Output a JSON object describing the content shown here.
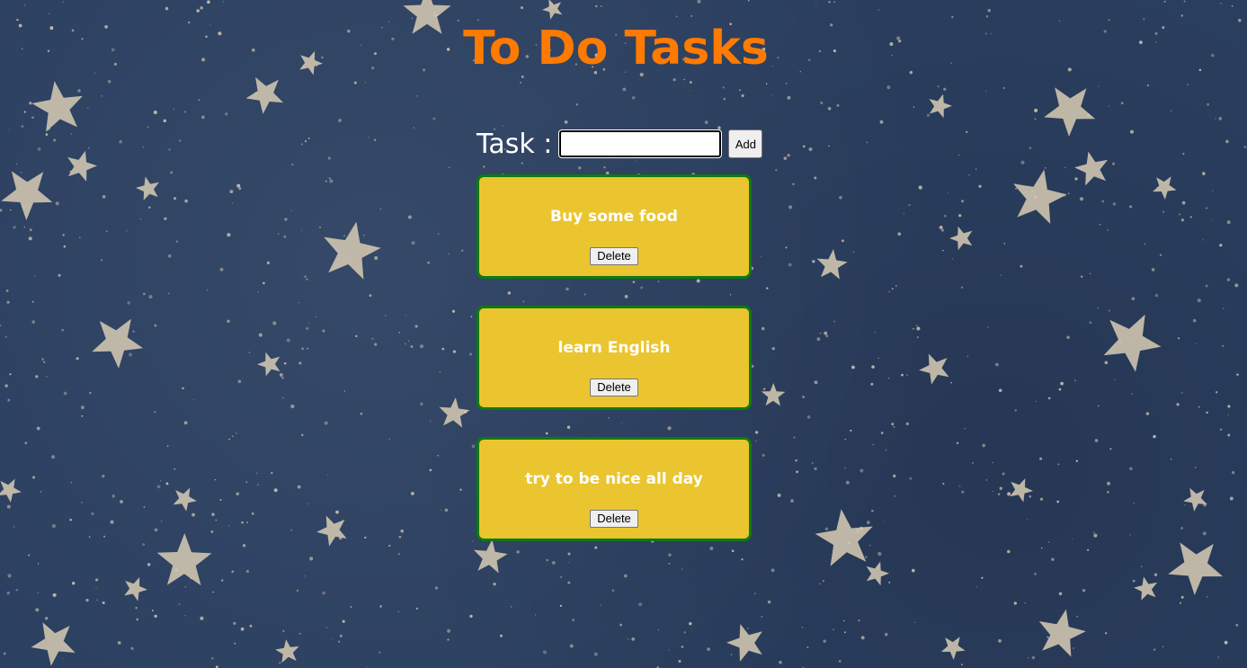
{
  "page": {
    "title": "To Do Tasks"
  },
  "form": {
    "label": "Task :",
    "input_value": "",
    "add_label": "Add"
  },
  "tasks": [
    {
      "text": "Buy some food",
      "delete_label": "Delete"
    },
    {
      "text": "learn English",
      "delete_label": "Delete"
    },
    {
      "text": "try to be nice all day",
      "delete_label": "Delete"
    }
  ],
  "colors": {
    "background": "#2b3f60",
    "title": "#ff7a00",
    "card_fill": "#eac52f",
    "card_border": "#0f7a0f",
    "task_text": "#ffffff",
    "star": "#d8ccb4"
  },
  "background_icon": "star-pattern"
}
